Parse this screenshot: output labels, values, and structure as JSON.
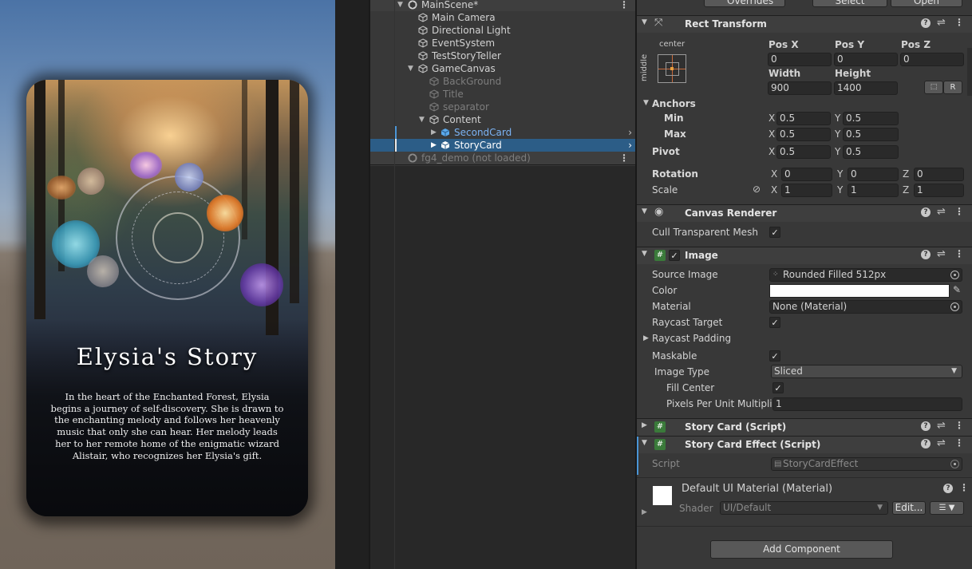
{
  "game": {
    "card_title": "Elysia's Story",
    "card_text": "In the heart of the Enchanted Forest, Elysia begins a journey of self-discovery. She is drawn to the enchanting melody and follows her heavenly music that only she can hear. Her melody leads her to her remote home of the enigmatic wizard Alistair, who recognizes her Elysia's gift."
  },
  "hierarchy": {
    "scene": "MainScene*",
    "items": [
      {
        "label": "Main Camera"
      },
      {
        "label": "Directional Light"
      },
      {
        "label": "EventSystem"
      },
      {
        "label": "TestStoryTeller"
      },
      {
        "label": "GameCanvas"
      },
      {
        "label": "BackGround"
      },
      {
        "label": "Title"
      },
      {
        "label": "separator"
      },
      {
        "label": "Content"
      },
      {
        "label": "SecondCard"
      },
      {
        "label": "StoryCard"
      }
    ],
    "other_scene": "fg4_demo (not loaded)"
  },
  "inspector": {
    "top": {
      "overrides": "Overrides",
      "select": "Select",
      "open": "Open"
    },
    "rect_transform": {
      "title": "Rect Transform",
      "anchor_h": "center",
      "anchor_v": "middle",
      "pos_x_label": "Pos X",
      "pos_y_label": "Pos Y",
      "pos_z_label": "Pos Z",
      "pos_x": "0",
      "pos_y": "0",
      "pos_z": "0",
      "width_label": "Width",
      "height_label": "Height",
      "width": "900",
      "height": "1400",
      "raw_btn": "R",
      "anchors_label": "Anchors",
      "min_label": "Min",
      "max_label": "Max",
      "min_x": "0.5",
      "min_y": "0.5",
      "max_x": "0.5",
      "max_y": "0.5",
      "pivot_label": "Pivot",
      "pivot_x": "0.5",
      "pivot_y": "0.5",
      "rotation_label": "Rotation",
      "rot_x": "0",
      "rot_y": "0",
      "rot_z": "0",
      "scale_label": "Scale",
      "scale_x": "1",
      "scale_y": "1",
      "scale_z": "1",
      "axis_x": "X",
      "axis_y": "Y",
      "axis_z": "Z"
    },
    "canvas_renderer": {
      "title": "Canvas Renderer",
      "cull_label": "Cull Transparent Mesh"
    },
    "image": {
      "title": "Image",
      "source_label": "Source Image",
      "source_value": "Rounded Filled 512px",
      "color_label": "Color",
      "material_label": "Material",
      "material_value": "None (Material)",
      "raycast_target_label": "Raycast Target",
      "raycast_padding_label": "Raycast Padding",
      "maskable_label": "Maskable",
      "image_type_label": "Image Type",
      "image_type_value": "Sliced",
      "fill_center_label": "Fill Center",
      "ppu_label": "Pixels Per Unit Multiplie",
      "ppu_value": "1"
    },
    "story_card": {
      "title": "Story Card (Script)"
    },
    "story_card_effect": {
      "title": "Story Card Effect (Script)",
      "script_label": "Script",
      "script_value": "StoryCardEffect"
    },
    "material": {
      "title": "Default UI Material (Material)",
      "shader_label": "Shader",
      "shader_value": "UI/Default",
      "edit_btn": "Edit..."
    },
    "add_component": "Add Component"
  },
  "colors": {
    "selection": "#2c5d87",
    "blue_text": "#7bb3f4",
    "panel": "#383838"
  }
}
